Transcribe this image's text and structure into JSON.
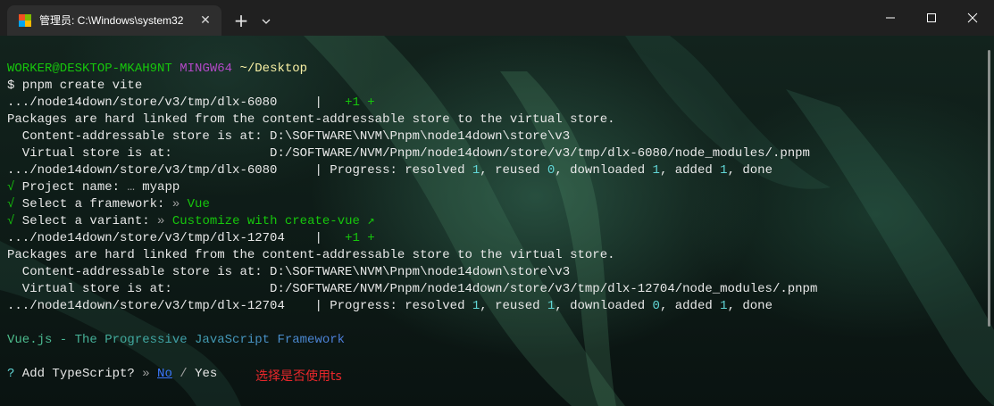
{
  "window": {
    "tab_title": "管理员: C:\\Windows\\system32",
    "tab_close": "✕",
    "new_tab": "+"
  },
  "terminal": {
    "prompt": {
      "user_host": "WORKER@DESKTOP-MKAH9NT",
      "shell": "MINGW64",
      "path": "~/Desktop",
      "command": "$ pnpm create vite"
    },
    "lines": {
      "l1_path": ".../node14down/store/v3/tmp/dlx-6080     |   ",
      "l1_plus": "+1 +",
      "l2": "Packages are hard linked from the content-addressable store to the virtual store.",
      "l3": "  Content-addressable store is at: D:\\SOFTWARE\\NVM\\Pnpm\\node14down\\store\\v3",
      "l4": "  Virtual store is at:             D:/SOFTWARE/NVM/Pnpm/node14down/store/v3/tmp/dlx-6080/node_modules/.pnpm",
      "l5_prefix": ".../node14down/store/v3/tmp/dlx-6080     | Progress: resolved ",
      "l5_resolved": "1",
      "l5_reused_label": ", reused ",
      "l5_reused": "0",
      "l5_downloaded_label": ", downloaded ",
      "l5_downloaded": "1",
      "l5_added_label": ", added ",
      "l5_added": "1",
      "l5_done": ", done",
      "check": "√",
      "l6_label": " Project name: ",
      "l6_dots": "… ",
      "l6_value": "myapp",
      "l7_label": " Select a framework: ",
      "l7_sep": "» ",
      "l7_value": "Vue",
      "l8_label": " Select a variant: ",
      "l8_sep": "» ",
      "l8_value": "Customize with create-vue ↗",
      "l9_path": ".../node14down/store/v3/tmp/dlx-12704    |   ",
      "l9_plus": "+1 +",
      "l10": "Packages are hard linked from the content-addressable store to the virtual store.",
      "l11": "  Content-addressable store is at: D:\\SOFTWARE\\NVM\\Pnpm\\node14down\\store\\v3",
      "l12": "  Virtual store is at:             D:/SOFTWARE/NVM/Pnpm/node14down/store/v3/tmp/dlx-12704/node_modules/.pnpm",
      "l13_prefix": ".../node14down/store/v3/tmp/dlx-12704    | Progress: resolved ",
      "l13_resolved": "1",
      "l13_reused_label": ", reused ",
      "l13_reused": "1",
      "l13_downloaded_label": ", downloaded ",
      "l13_downloaded": "0",
      "l13_added_label": ", added ",
      "l13_added": "1",
      "l13_done": ", done",
      "vue_banner": "Vue.js - The Progressive JavaScript Framework",
      "q_mark": "?",
      "ts_question": " Add TypeScript? ",
      "ts_sep": "» ",
      "ts_no": "No",
      "ts_slash": " / ",
      "ts_yes": "Yes"
    },
    "annotation": "选择是否使用ts"
  },
  "colors": {
    "prompt_user": "#16c60c",
    "prompt_shell": "#b148c6",
    "prompt_path": "#f9f1a5",
    "number": "#61d6d6",
    "vue_green": "#42b883",
    "selected_option": "#3b78ff",
    "annotation": "#e8272b"
  },
  "icons": {
    "tab_icon": "git-bash-icon",
    "dropdown": "chevron-down-icon",
    "minimize": "minimize-icon",
    "maximize": "maximize-icon",
    "close": "close-icon"
  }
}
